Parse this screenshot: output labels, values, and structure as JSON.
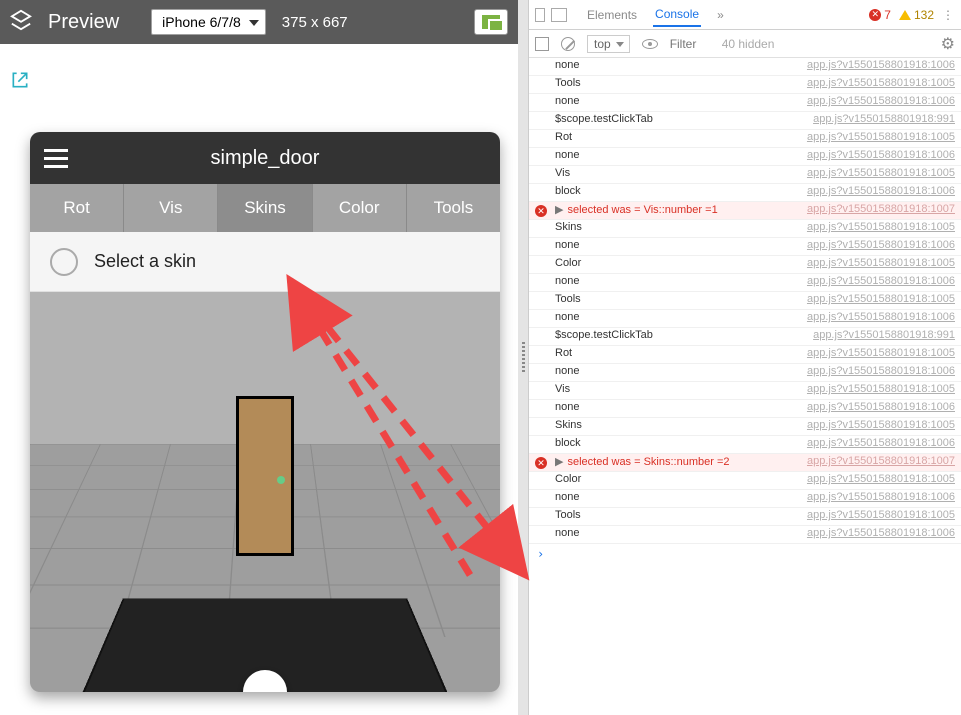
{
  "preview": {
    "title": "Preview",
    "device_name": "iPhone 6/7/8",
    "dimensions": "375 x 667"
  },
  "phone": {
    "title": "simple_door",
    "tabs": [
      "Rot",
      "Vis",
      "Skins",
      "Color",
      "Tools"
    ],
    "active_tab_index": 2,
    "select_label": "Select a skin"
  },
  "devtools": {
    "tabs": {
      "elements": "Elements",
      "console": "Console"
    },
    "error_count": "7",
    "warn_count": "132",
    "context": "top",
    "filter_placeholder": "Filter",
    "hidden_text": "40 hidden",
    "console": [
      {
        "type": "log",
        "msg": "none",
        "src": "app.js?v1550158801918:1006"
      },
      {
        "type": "log",
        "msg": "Tools",
        "src": "app.js?v1550158801918:1005"
      },
      {
        "type": "log",
        "msg": "none",
        "src": "app.js?v1550158801918:1006"
      },
      {
        "type": "log",
        "msg": "$scope.testClickTab",
        "src": "app.js?v1550158801918:991"
      },
      {
        "type": "log",
        "msg": "Rot",
        "src": "app.js?v1550158801918:1005"
      },
      {
        "type": "log",
        "msg": "none",
        "src": "app.js?v1550158801918:1006"
      },
      {
        "type": "log",
        "msg": "Vis",
        "src": "app.js?v1550158801918:1005"
      },
      {
        "type": "log",
        "msg": "block",
        "src": "app.js?v1550158801918:1006"
      },
      {
        "type": "err",
        "msg": "selected was = Vis::number =1",
        "src": "app.js?v1550158801918:1007"
      },
      {
        "type": "log",
        "msg": "Skins",
        "src": "app.js?v1550158801918:1005"
      },
      {
        "type": "log",
        "msg": "none",
        "src": "app.js?v1550158801918:1006"
      },
      {
        "type": "log",
        "msg": "Color",
        "src": "app.js?v1550158801918:1005"
      },
      {
        "type": "log",
        "msg": "none",
        "src": "app.js?v1550158801918:1006"
      },
      {
        "type": "log",
        "msg": "Tools",
        "src": "app.js?v1550158801918:1005"
      },
      {
        "type": "log",
        "msg": "none",
        "src": "app.js?v1550158801918:1006"
      },
      {
        "type": "log",
        "msg": "$scope.testClickTab",
        "src": "app.js?v1550158801918:991"
      },
      {
        "type": "log",
        "msg": "Rot",
        "src": "app.js?v1550158801918:1005"
      },
      {
        "type": "log",
        "msg": "none",
        "src": "app.js?v1550158801918:1006"
      },
      {
        "type": "log",
        "msg": "Vis",
        "src": "app.js?v1550158801918:1005"
      },
      {
        "type": "log",
        "msg": "none",
        "src": "app.js?v1550158801918:1006"
      },
      {
        "type": "log",
        "msg": "Skins",
        "src": "app.js?v1550158801918:1005"
      },
      {
        "type": "log",
        "msg": "block",
        "src": "app.js?v1550158801918:1006"
      },
      {
        "type": "err",
        "msg": "selected was = Skins::number =2",
        "src": "app.js?v1550158801918:1007"
      },
      {
        "type": "log",
        "msg": "Color",
        "src": "app.js?v1550158801918:1005"
      },
      {
        "type": "log",
        "msg": "none",
        "src": "app.js?v1550158801918:1006"
      },
      {
        "type": "log",
        "msg": "Tools",
        "src": "app.js?v1550158801918:1005"
      },
      {
        "type": "log",
        "msg": "none",
        "src": "app.js?v1550158801918:1006"
      }
    ],
    "prompt": "›"
  }
}
